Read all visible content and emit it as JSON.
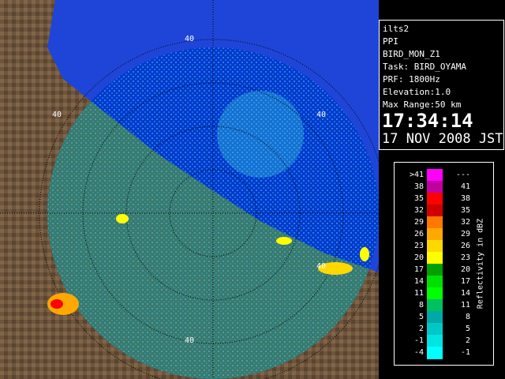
{
  "radar": {
    "range_ring_labels": [
      "40",
      "40",
      "40",
      "40",
      "40"
    ],
    "colors": {
      "sea": "#003ad0",
      "land": "#6e553c",
      "outside": "#1f45d8",
      "rings": "#000000"
    }
  },
  "info_panel": {
    "lines": [
      "ilts2",
      "PPI",
      "BIRD_MON_Z1",
      "Task: BIRD_OYAMA",
      "PRF: 1800Hz",
      "Elevation:1.0",
      "Max Range:50 km"
    ],
    "time": "17:34:14",
    "date": "17 NOV 2008 JST"
  },
  "legend": {
    "unit": "Reflectivity in dBZ",
    "rows": [
      {
        "lo": ">41",
        "hi": "---",
        "color": "#ff00ff"
      },
      {
        "lo": "38",
        "hi": "41",
        "color": "#c000a0"
      },
      {
        "lo": "35",
        "hi": "38",
        "color": "#ff0000"
      },
      {
        "lo": "32",
        "hi": "35",
        "color": "#d00000"
      },
      {
        "lo": "29",
        "hi": "32",
        "color": "#ff7800"
      },
      {
        "lo": "26",
        "hi": "29",
        "color": "#ffa800"
      },
      {
        "lo": "23",
        "hi": "26",
        "color": "#ffd800"
      },
      {
        "lo": "20",
        "hi": "23",
        "color": "#ffff00"
      },
      {
        "lo": "17",
        "hi": "20",
        "color": "#00a000"
      },
      {
        "lo": "14",
        "hi": "17",
        "color": "#00e000"
      },
      {
        "lo": "11",
        "hi": "14",
        "color": "#00ff00"
      },
      {
        "lo": "8",
        "hi": "11",
        "color": "#00c060"
      },
      {
        "lo": "5",
        "hi": "8",
        "color": "#00a8a8"
      },
      {
        "lo": "2",
        "hi": "5",
        "color": "#00c8c8"
      },
      {
        "lo": "-1",
        "hi": "2",
        "color": "#00e4e4"
      },
      {
        "lo": "-4",
        "hi": "-1",
        "color": "#00ffff"
      }
    ]
  }
}
